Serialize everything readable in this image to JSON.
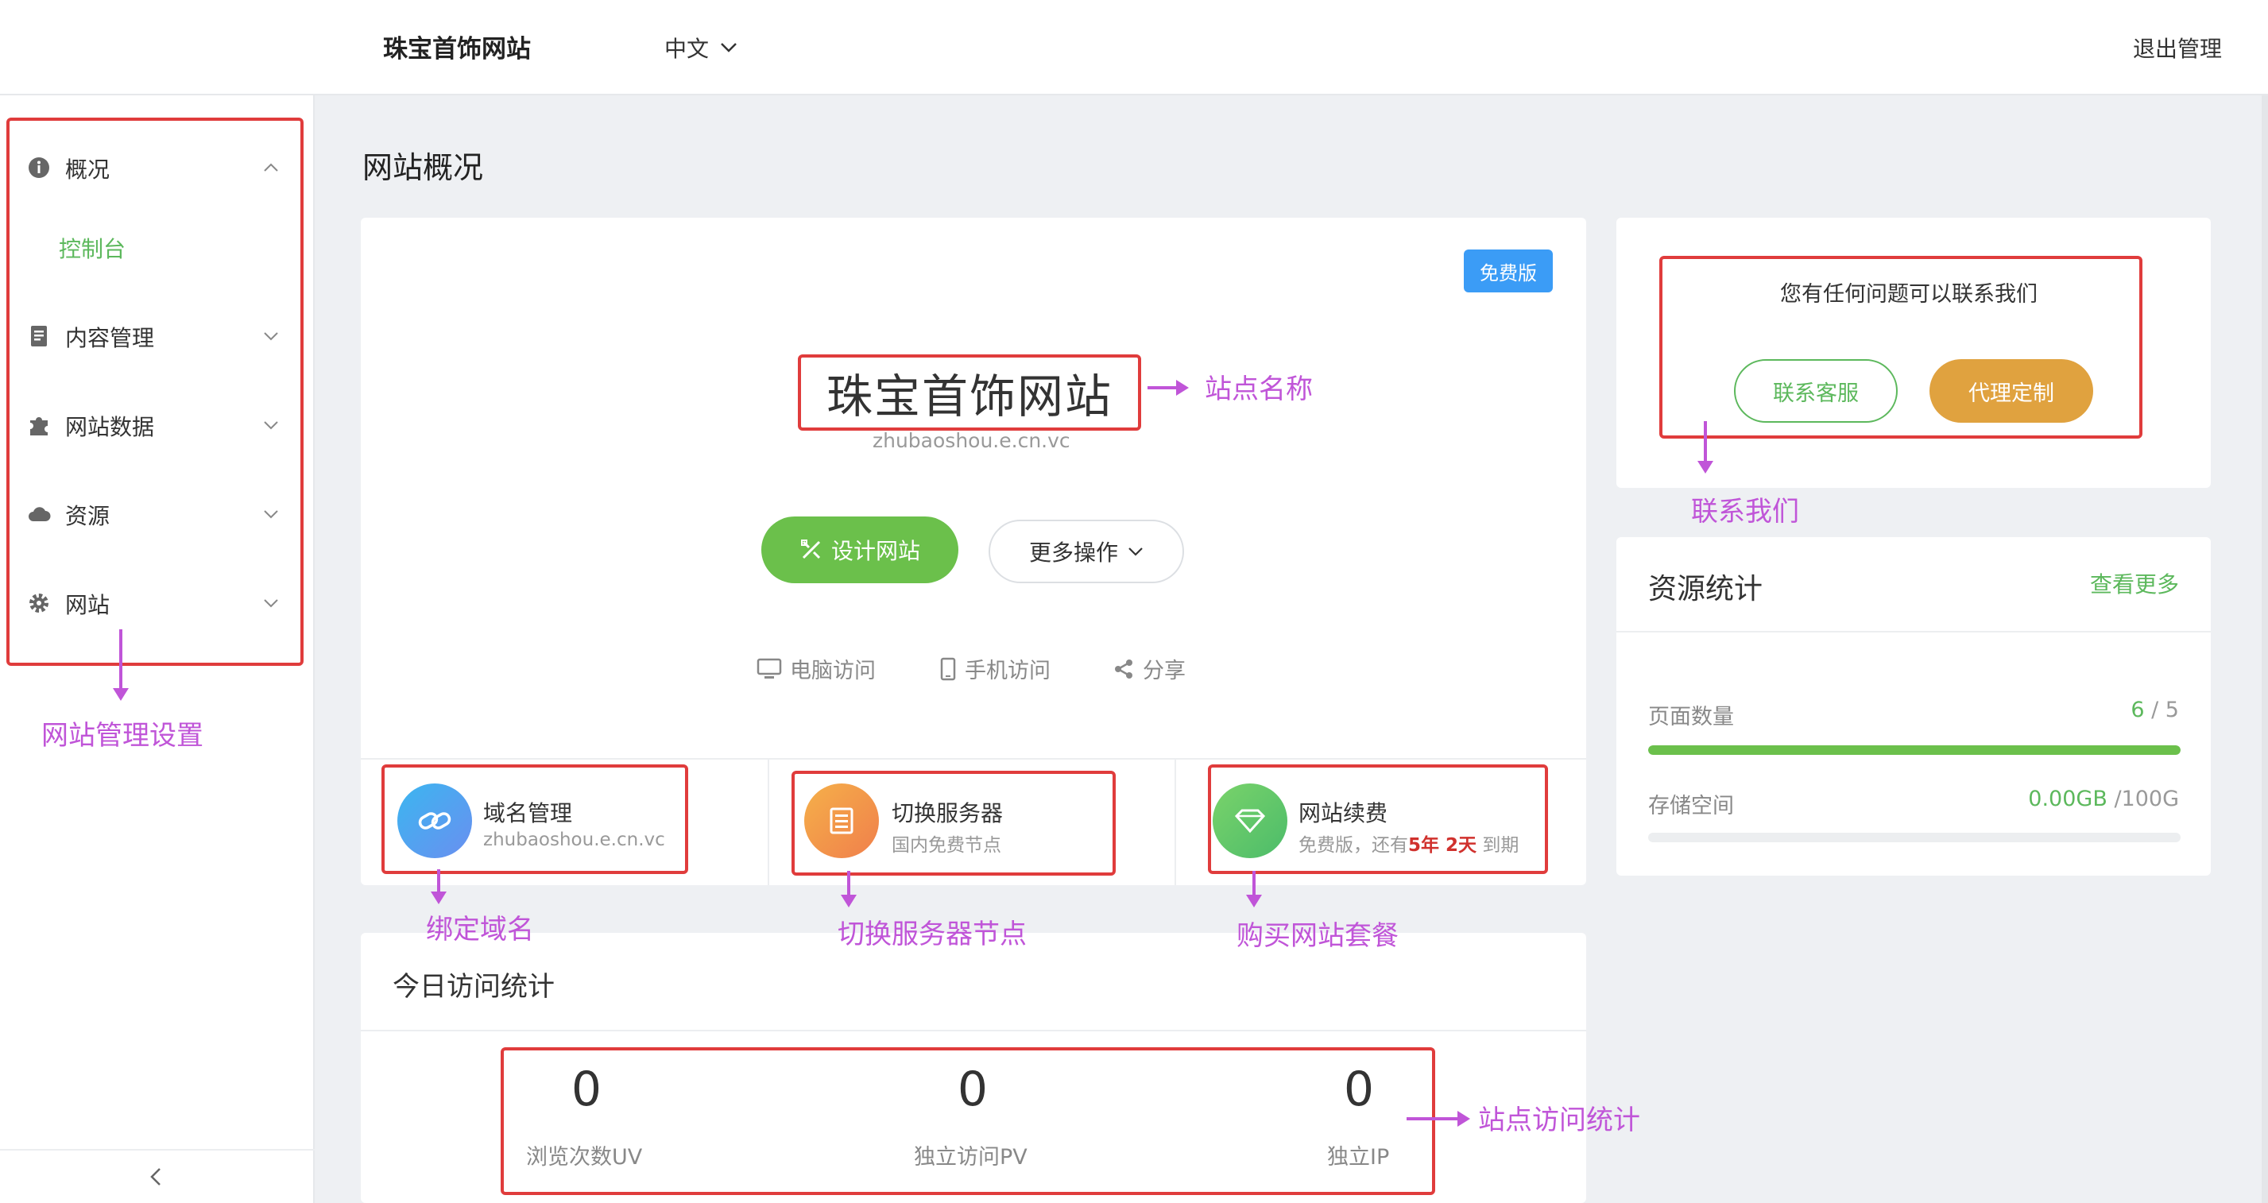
{
  "header": {
    "brand": "珠宝首饰网站",
    "language": "中文",
    "logout": "退出管理"
  },
  "sidebar": {
    "items": [
      {
        "label": "概况",
        "icon": "info-icon"
      },
      {
        "label": "内容管理",
        "icon": "document-icon"
      },
      {
        "label": "网站数据",
        "icon": "puzzle-icon"
      },
      {
        "label": "资源",
        "icon": "cloud-icon"
      },
      {
        "label": "网站",
        "icon": "gear-icon"
      }
    ],
    "sub_item": "控制台"
  },
  "page": {
    "title": "网站概况"
  },
  "site": {
    "plan_badge": "免费版",
    "name": "珠宝首饰网站",
    "domain": "zhubaoshou.e.cn.vc",
    "design_button": "设计网站",
    "more_button": "更多操作",
    "access": {
      "pc": "电脑访问",
      "mobile": "手机访问",
      "share": "分享"
    }
  },
  "services": [
    {
      "title": "域名管理",
      "sub": "zhubaoshou.e.cn.vc"
    },
    {
      "title": "切换服务器",
      "sub": "国内免费节点"
    },
    {
      "title": "网站续费",
      "sub_prefix": "免费版，还有",
      "sub_highlight": "5年 2天",
      "sub_suffix": " 到期"
    }
  ],
  "stats": {
    "title": "今日访问统计",
    "items": [
      {
        "value": "0",
        "label": "浏览次数UV"
      },
      {
        "value": "0",
        "label": "独立访问PV"
      },
      {
        "value": "0",
        "label": "独立IP"
      }
    ]
  },
  "contact": {
    "text": "您有任何问题可以联系我们",
    "service_button": "联系客服",
    "agent_button": "代理定制"
  },
  "resources": {
    "title": "资源统计",
    "more": "查看更多",
    "pages_label": "页面数量",
    "pages_used": "6",
    "pages_total": " / 5",
    "pages_fraction": 1.0,
    "storage_label": "存储空间",
    "storage_used": "0.00GB",
    "storage_total": " /100G",
    "storage_fraction": 0.0
  },
  "annotations": {
    "site_name": "站点名称",
    "contact_us": "联系我们",
    "sidebar": "网站管理设置",
    "bind_domain": "绑定域名",
    "switch_server": "切换服务器节点",
    "buy_plan": "购买网站套餐",
    "visit_stats": "站点访问统计"
  },
  "colors": {
    "accent_green": "#6bc04b",
    "badge_blue": "#3b9cf6",
    "agent_orange": "#e0a23f",
    "annotation_red": "#e03c3c",
    "annotation_purple": "#c055d8"
  }
}
